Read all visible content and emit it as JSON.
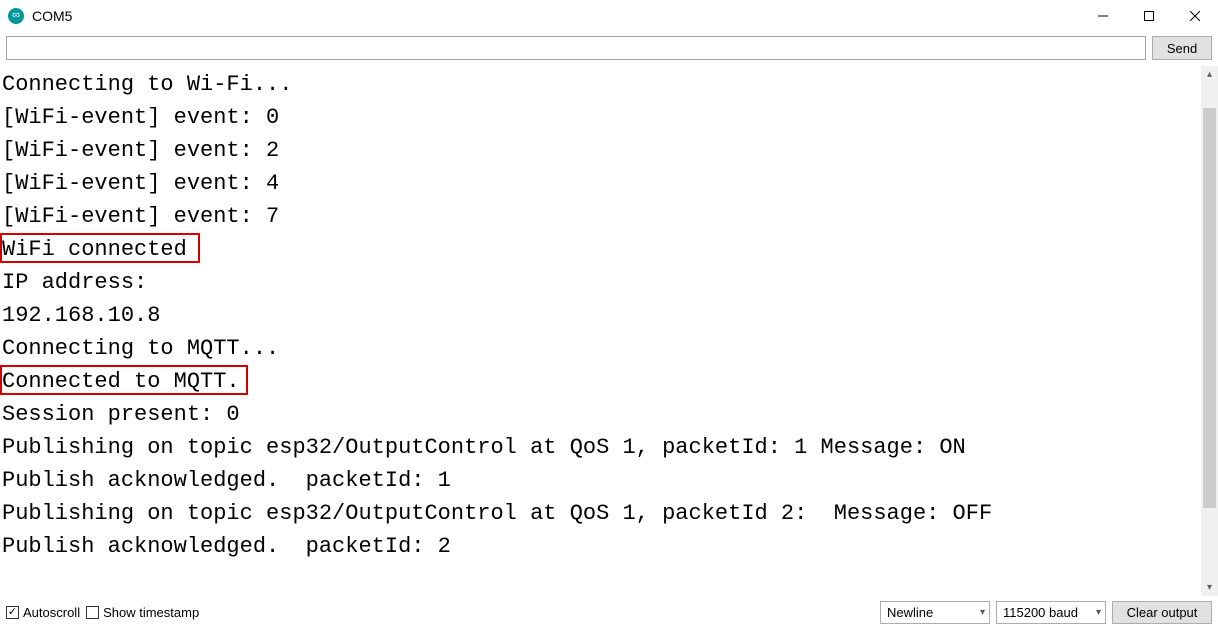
{
  "window": {
    "title": "COM5"
  },
  "toolbar": {
    "input_value": "",
    "send_label": "Send"
  },
  "output": {
    "lines": [
      "Connecting to Wi-Fi...",
      "[WiFi-event] event: 0",
      "[WiFi-event] event: 2",
      "[WiFi-event] event: 4",
      "[WiFi-event] event: 7",
      "WiFi connected",
      "IP address:",
      "192.168.10.8",
      "Connecting to MQTT...",
      "Connected to MQTT.",
      "Session present: 0",
      "Publishing on topic esp32/OutputControl at QoS 1, packetId: 1 Message: ON",
      "Publish acknowledged.  packetId: 1",
      "Publishing on topic esp32/OutputControl at QoS 1, packetId 2:  Message: OFF",
      "Publish acknowledged.  packetId: 2"
    ]
  },
  "footer": {
    "autoscroll_label": "Autoscroll",
    "autoscroll_checked": true,
    "timestamp_label": "Show timestamp",
    "timestamp_checked": false,
    "line_ending": "Newline",
    "baud": "115200 baud",
    "clear_label": "Clear output"
  }
}
